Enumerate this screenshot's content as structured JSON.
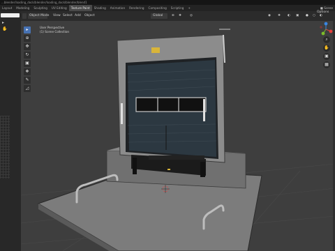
{
  "title": "...blender/loading_dock/blender/loading_dock/blender/blend1",
  "workspaces": [
    "Layout",
    "Modeling",
    "Sculpting",
    "UV Editing",
    "Texture Paint",
    "Shading",
    "Animation",
    "Rendering",
    "Compositing",
    "Scripting",
    "+"
  ],
  "active_workspace": "Texture Paint",
  "scene_label": "Scene",
  "header": {
    "mode": "Object Mode",
    "menus": [
      "View",
      "Select",
      "Add",
      "Object"
    ],
    "transform": "Global",
    "options": "Options"
  },
  "viewport": {
    "perspective": "User Perspective",
    "collection": "(1) Scene Collection"
  },
  "tools": [
    {
      "name": "select-box",
      "glyph": "▸",
      "active": true
    },
    {
      "name": "cursor",
      "glyph": "⊕",
      "active": false
    },
    {
      "name": "move",
      "glyph": "✥",
      "active": false
    },
    {
      "name": "rotate",
      "glyph": "↻",
      "active": false
    },
    {
      "name": "scale",
      "glyph": "▣",
      "active": false
    },
    {
      "name": "transform",
      "glyph": "❖",
      "active": false
    },
    {
      "name": "annotate",
      "glyph": "✎",
      "active": false
    },
    {
      "name": "measure",
      "glyph": "◿",
      "active": false
    }
  ],
  "nav_buttons": [
    "⌕",
    "✋",
    "▣",
    "▦"
  ],
  "gizmo_axes": {
    "x_color": "#e5413c",
    "y_color": "#7cbd29",
    "z_color": "#3a86e0"
  },
  "accent": "#4772b3"
}
